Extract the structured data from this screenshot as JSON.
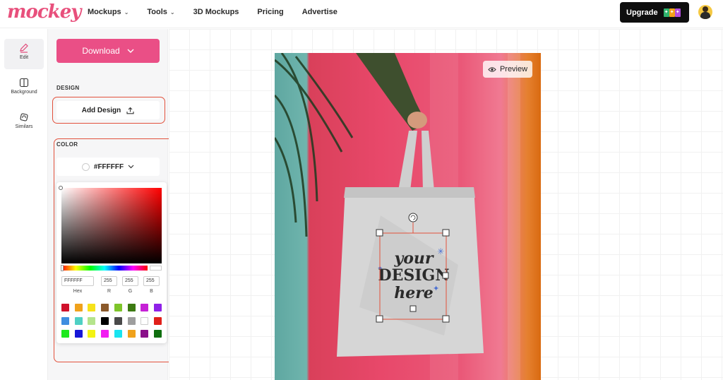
{
  "header": {
    "logo": "mockey",
    "nav": [
      {
        "label": "Mockups",
        "has_dropdown": true
      },
      {
        "label": "Tools",
        "has_dropdown": true
      },
      {
        "label": "3D Mockups",
        "has_dropdown": false
      },
      {
        "label": "Pricing",
        "has_dropdown": false
      },
      {
        "label": "Advertise",
        "has_dropdown": false
      }
    ],
    "upgrade_label": "Upgrade"
  },
  "rail": {
    "items": [
      {
        "label": "Edit",
        "icon": "pencil-icon"
      },
      {
        "label": "Background",
        "icon": "background-icon"
      },
      {
        "label": "Similars",
        "icon": "similars-icon"
      }
    ]
  },
  "panel": {
    "download_label": "Download",
    "design_section": "DESIGN",
    "add_design_label": "Add Design",
    "color_section": "COLOR",
    "selected_color": "#FFFFFF"
  },
  "picker": {
    "hex": "FFFFFF",
    "r": "255",
    "g": "255",
    "b": "255",
    "labels": {
      "hex": "Hex",
      "r": "R",
      "g": "G",
      "b": "B"
    },
    "palette": [
      "#d0112b",
      "#f0a21c",
      "#f6e21b",
      "#8b5a2b",
      "#7ec52a",
      "#3c7a12",
      "#c621d6",
      "#8f21e8",
      "#3f8ee0",
      "#4fd0c4",
      "#b5e48c",
      "#000000",
      "#4a4a4a",
      "#9e9e9e",
      "#ffffff",
      "#e0201a",
      "#1de91d",
      "#1717d8",
      "#f3f312",
      "#f21df2",
      "#19e4f0",
      "#f0a21c",
      "#8a0f8a",
      "#0f6f0f"
    ]
  },
  "canvas": {
    "preview_label": "Preview",
    "design_text": {
      "line1": "your",
      "line2": "DESIGN",
      "line3": "here"
    }
  },
  "colors": {
    "accent": "#ea4f86",
    "highlight_outline": "#e2513c"
  }
}
